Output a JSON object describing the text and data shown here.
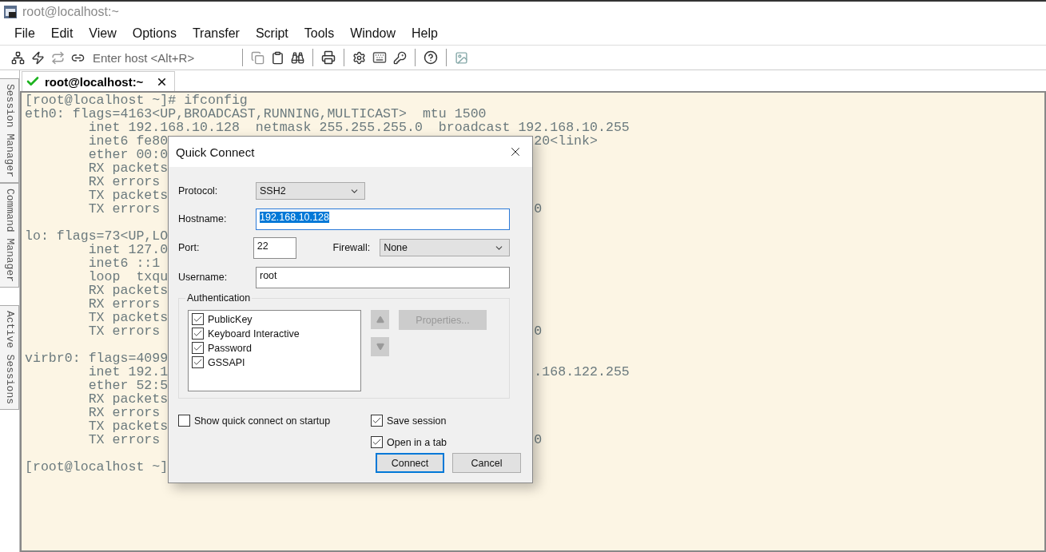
{
  "window": {
    "title": "root@localhost:~"
  },
  "menu": [
    "File",
    "Edit",
    "View",
    "Options",
    "Transfer",
    "Script",
    "Tools",
    "Window",
    "Help"
  ],
  "toolbar": {
    "host_field": {
      "placeholder": "Enter host <Alt+R>"
    }
  },
  "side_tabs": [
    "Session Manager",
    "Command Manager",
    "Active Sessions"
  ],
  "session_tabs": [
    {
      "label": "root@localhost:~",
      "connected": true,
      "selected": true
    }
  ],
  "terminal": {
    "blocks": [
      [
        {
          "text": "[root@localhost ~]# ifconfig"
        },
        {
          "text": "eth0: flags=4163<UP,BROADCAST,RUNNING,MULTICAST>  mtu 1500"
        },
        {
          "text": "        inet 192.168.10.128  netmask 255.255.255.0  broadcast 192.168.10.255"
        },
        {
          "text": "        inet6 fe80",
          "tail": "20<link>"
        },
        {
          "text": "        ether 00:0"
        },
        {
          "text": "        RX packets"
        },
        {
          "text": "        RX errors"
        },
        {
          "text": "        TX packets"
        },
        {
          "text": "        TX errors",
          "tail": "0"
        }
      ],
      [
        {
          "text": "lo: flags=73<UP,LO"
        },
        {
          "text": "        inet 127.0"
        },
        {
          "text": "        inet6 ::1"
        },
        {
          "text": "        loop  txqu"
        },
        {
          "text": "        RX packets"
        },
        {
          "text": "        RX errors"
        },
        {
          "text": "        TX packets"
        },
        {
          "text": "        TX errors",
          "tail": "0"
        }
      ],
      [
        {
          "text": "virbr0: flags=4099"
        },
        {
          "text": "        inet 192.1",
          "tail": ".168.122.255"
        },
        {
          "text": "        ether 52:5"
        },
        {
          "text": "        RX packets"
        },
        {
          "text": "        RX errors"
        },
        {
          "text": "        TX packets"
        },
        {
          "text": "        TX errors",
          "tail": "0"
        }
      ],
      [
        {
          "text": "[root@localhost ~]"
        }
      ]
    ]
  },
  "dialog": {
    "title": "Quick Connect",
    "protocol": {
      "label": "Protocol:",
      "value": "SSH2"
    },
    "hostname": {
      "label": "Hostname:",
      "value": "192.168.10.128",
      "selected": true
    },
    "port": {
      "label": "Port:",
      "value": "22"
    },
    "firewall": {
      "label": "Firewall:",
      "value": "None"
    },
    "username": {
      "label": "Username:",
      "value": "root"
    },
    "authentication": {
      "title": "Authentication",
      "methods": [
        {
          "label": "PublicKey",
          "checked": true
        },
        {
          "label": "Keyboard Interactive",
          "checked": true
        },
        {
          "label": "Password",
          "checked": true
        },
        {
          "label": "GSSAPI",
          "checked": true
        }
      ]
    },
    "properties_button": {
      "label": "Properties...",
      "disabled": true
    },
    "options": [
      {
        "label": "Show quick connect on startup",
        "checked": false
      },
      {
        "label": "Save session",
        "checked": true
      },
      {
        "label": "Open in a tab",
        "checked": true
      }
    ],
    "buttons": [
      {
        "label": "Connect",
        "default": true
      },
      {
        "label": "Cancel",
        "default": false
      }
    ]
  }
}
